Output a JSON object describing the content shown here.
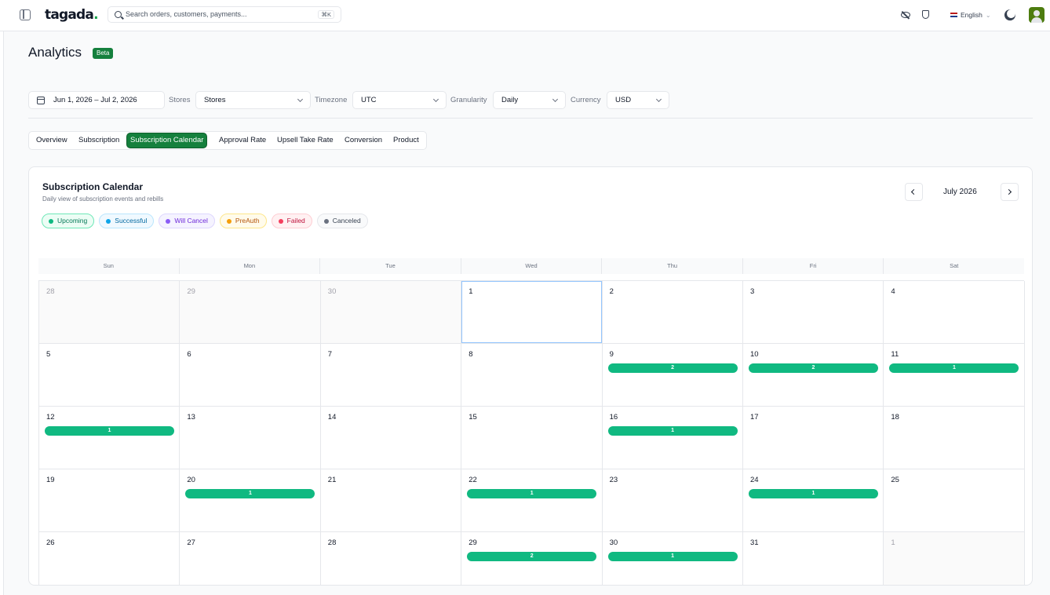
{
  "app": {
    "logo": "tagada",
    "logo_dot": "."
  },
  "search": {
    "placeholder": "Search orders, customers, payments...",
    "shortcut": "⌘K"
  },
  "header": {
    "language": "English"
  },
  "page": {
    "title": "Analytics",
    "badge": "Beta"
  },
  "filters": {
    "date_range": "Jun 1, 2026 – Jul 2, 2026",
    "stores_label": "Stores",
    "stores_value": "Stores",
    "timezone_label": "Timezone",
    "timezone_value": "UTC",
    "granularity_label": "Granularity",
    "granularity_value": "Daily",
    "currency_label": "Currency",
    "currency_value": "USD"
  },
  "tabs": [
    "Overview",
    "Subscription",
    "Subscription Calendar",
    "Approval Rate",
    "Upsell Take Rate",
    "Conversion",
    "Product"
  ],
  "active_tab": "Subscription Calendar",
  "calendar": {
    "title": "Subscription Calendar",
    "subtitle": "Daily view of subscription events and rebills",
    "month": "July 2026",
    "legend": [
      {
        "label": "Upcoming",
        "color": "#10b981",
        "text": "#047857",
        "bg": "#ecfdf5",
        "border": "#6ee7b7"
      },
      {
        "label": "Successful",
        "color": "#0ea5e9",
        "text": "#0369a1",
        "bg": "#f0f9ff",
        "border": "#bae6fd"
      },
      {
        "label": "Will Cancel",
        "color": "#8b5cf6",
        "text": "#6d28d9",
        "bg": "#f5f3ff",
        "border": "#ddd6fe"
      },
      {
        "label": "PreAuth",
        "color": "#f59e0b",
        "text": "#b45309",
        "bg": "#fffbeb",
        "border": "#fde68a"
      },
      {
        "label": "Failed",
        "color": "#f43f5e",
        "text": "#be123c",
        "bg": "#fff1f2",
        "border": "#fecdd3"
      },
      {
        "label": "Canceled",
        "color": "#6b7280",
        "text": "#374151",
        "bg": "#f9fafb",
        "border": "#e5e7eb"
      }
    ],
    "weekdays": [
      "Sun",
      "Mon",
      "Tue",
      "Wed",
      "Thu",
      "Fri",
      "Sat"
    ],
    "weeks": [
      [
        {
          "day": "28",
          "other": true
        },
        {
          "day": "29",
          "other": true
        },
        {
          "day": "30",
          "other": true
        },
        {
          "day": "1",
          "today": true
        },
        {
          "day": "2"
        },
        {
          "day": "3"
        },
        {
          "day": "4"
        }
      ],
      [
        {
          "day": "5"
        },
        {
          "day": "6"
        },
        {
          "day": "7"
        },
        {
          "day": "8"
        },
        {
          "day": "9",
          "count": "2"
        },
        {
          "day": "10",
          "count": "2"
        },
        {
          "day": "11",
          "count": "1"
        }
      ],
      [
        {
          "day": "12",
          "count": "1"
        },
        {
          "day": "13"
        },
        {
          "day": "14"
        },
        {
          "day": "15"
        },
        {
          "day": "16",
          "count": "1"
        },
        {
          "day": "17"
        },
        {
          "day": "18"
        }
      ],
      [
        {
          "day": "19"
        },
        {
          "day": "20",
          "count": "1"
        },
        {
          "day": "21"
        },
        {
          "day": "22",
          "count": "1"
        },
        {
          "day": "23"
        },
        {
          "day": "24",
          "count": "1"
        },
        {
          "day": "25"
        }
      ],
      [
        {
          "day": "26"
        },
        {
          "day": "27"
        },
        {
          "day": "28"
        },
        {
          "day": "29",
          "count": "2"
        },
        {
          "day": "30",
          "count": "1"
        },
        {
          "day": "31"
        },
        {
          "day": "1",
          "other": true
        }
      ]
    ]
  }
}
